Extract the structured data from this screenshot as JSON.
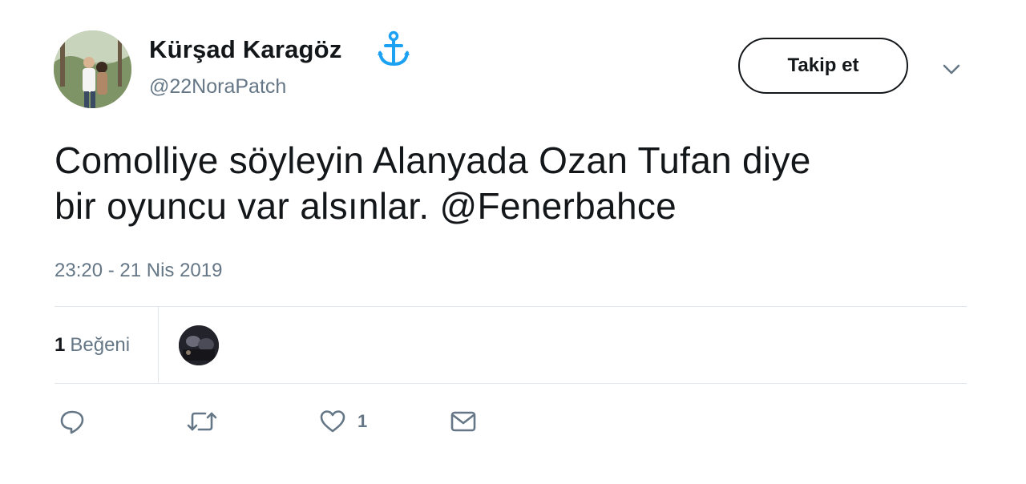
{
  "author": {
    "display_name": "Kürşad Karagöz",
    "username": "@22NoraPatch",
    "badge_icon": "anchor-icon",
    "badge_color": "#1da1f2"
  },
  "header": {
    "follow_label": "Takip et",
    "menu_icon": "chevron-down-icon"
  },
  "tweet": {
    "text_line1": "Comolliye söyleyin Alanyada Ozan Tufan diye",
    "text_line2_prefix": "bir oyuncu var alsınlar. ",
    "mention": "@Fenerbahce",
    "timestamp": "23:20 - 21 Nis 2019"
  },
  "stats": {
    "likes_count": "1",
    "likes_label": "Beğeni"
  },
  "actions": {
    "reply_icon": "reply-icon",
    "retweet_icon": "retweet-icon",
    "like_icon": "heart-icon",
    "like_count": "1",
    "dm_icon": "envelope-icon"
  },
  "colors": {
    "text": "#14171a",
    "secondary": "#657786",
    "divider": "#e1e8ed"
  }
}
